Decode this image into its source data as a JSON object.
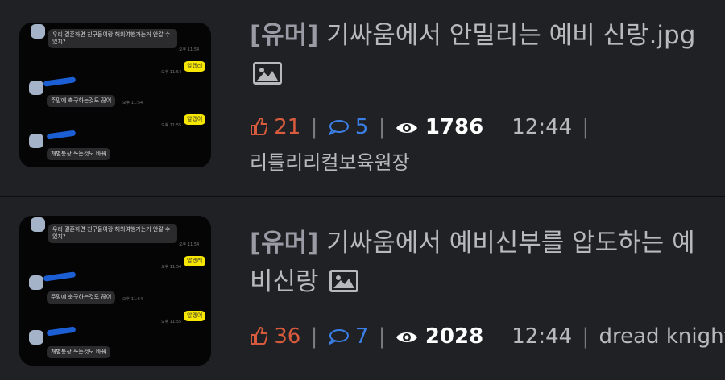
{
  "posts": [
    {
      "category": "[유머]",
      "title": "기싸움에서 안밀리는 예비 신랑.jpg",
      "has_image_icon": "image-icon",
      "likes": "21",
      "comments": "5",
      "views": "1786",
      "time": "12:44",
      "author": "리틀리리컬보육원장",
      "thumbnail": {
        "msg1": "우리 결혼하면 친구들이랑 해외여행가는거 안갈 수 있지?",
        "reply1": "알겠러",
        "msg2": "주말에 축구하는것도 끊어",
        "reply2": "알겠어",
        "msg3": "개별통장 쓰는것도 바꿔",
        "time1": "오후 11:54",
        "time2": "오후 11:54",
        "time3": "오후 11:55"
      }
    },
    {
      "category": "[유머]",
      "title": "기싸움에서 예비신부를 압도하는 예비신랑",
      "has_image_icon": "image-icon",
      "likes": "36",
      "comments": "7",
      "views": "2028",
      "time": "12:44",
      "author": "dread knight",
      "thumbnail": {
        "msg1": "우리 결혼하면 친구들이랑 해외여행가는거 안갈 수 있지?",
        "reply1": "알겠러",
        "msg2": "주말에 축구하는것도 끊어",
        "reply2": "알겠어",
        "msg3": "개별통장 쓰는것도 바꿔",
        "time1": "오후 11:54",
        "time2": "오후 11:54",
        "time3": "오후 11:55"
      }
    }
  ],
  "colors": {
    "background": "#202125",
    "likes": "#d95b3d",
    "comments": "#3b7fe6",
    "views": "#ffffff",
    "kakao_yellow": "#f7e600"
  },
  "icons": {
    "likes": "thumbs-up-icon",
    "comments": "speech-bubble-icon",
    "views": "eye-icon",
    "image": "image-icon"
  }
}
